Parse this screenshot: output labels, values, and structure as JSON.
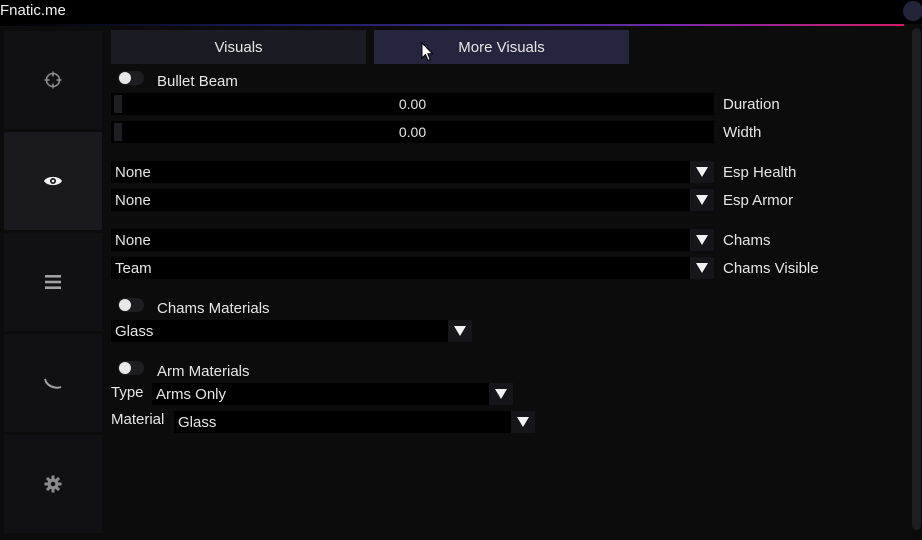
{
  "app": {
    "title": "Fnatic.me"
  },
  "sidebar": {
    "items": [
      {
        "icon": "crosshair-icon",
        "active": false
      },
      {
        "icon": "eye-icon",
        "active": true
      },
      {
        "icon": "menu-icon",
        "active": false
      },
      {
        "icon": "moon-icon",
        "active": false
      },
      {
        "icon": "gear-icon",
        "active": false
      }
    ]
  },
  "tabs": [
    {
      "label": "Visuals",
      "active": false
    },
    {
      "label": "More Visuals",
      "active": true
    }
  ],
  "bullet_beam": {
    "label": "Bullet Beam",
    "enabled": false,
    "duration": {
      "label": "Duration",
      "value": "0.00"
    },
    "width": {
      "label": "Width",
      "value": "0.00"
    }
  },
  "esp": {
    "health": {
      "label": "Esp Health",
      "value": "None"
    },
    "armor": {
      "label": "Esp Armor",
      "value": "None"
    }
  },
  "chams": {
    "chams": {
      "label": "Chams",
      "value": "None"
    },
    "visible": {
      "label": "Chams Visible",
      "value": "Team"
    }
  },
  "chams_materials": {
    "label": "Chams Materials",
    "enabled": false,
    "value": "Glass"
  },
  "arm_materials": {
    "label": "Arm Materials",
    "enabled": false,
    "type": {
      "label": "Type",
      "value": "Arms Only"
    },
    "material": {
      "label": "Material",
      "value": "Glass"
    }
  },
  "colors": {
    "accent": "#25253d",
    "background": "#0c0c0d",
    "control": "#000000"
  }
}
